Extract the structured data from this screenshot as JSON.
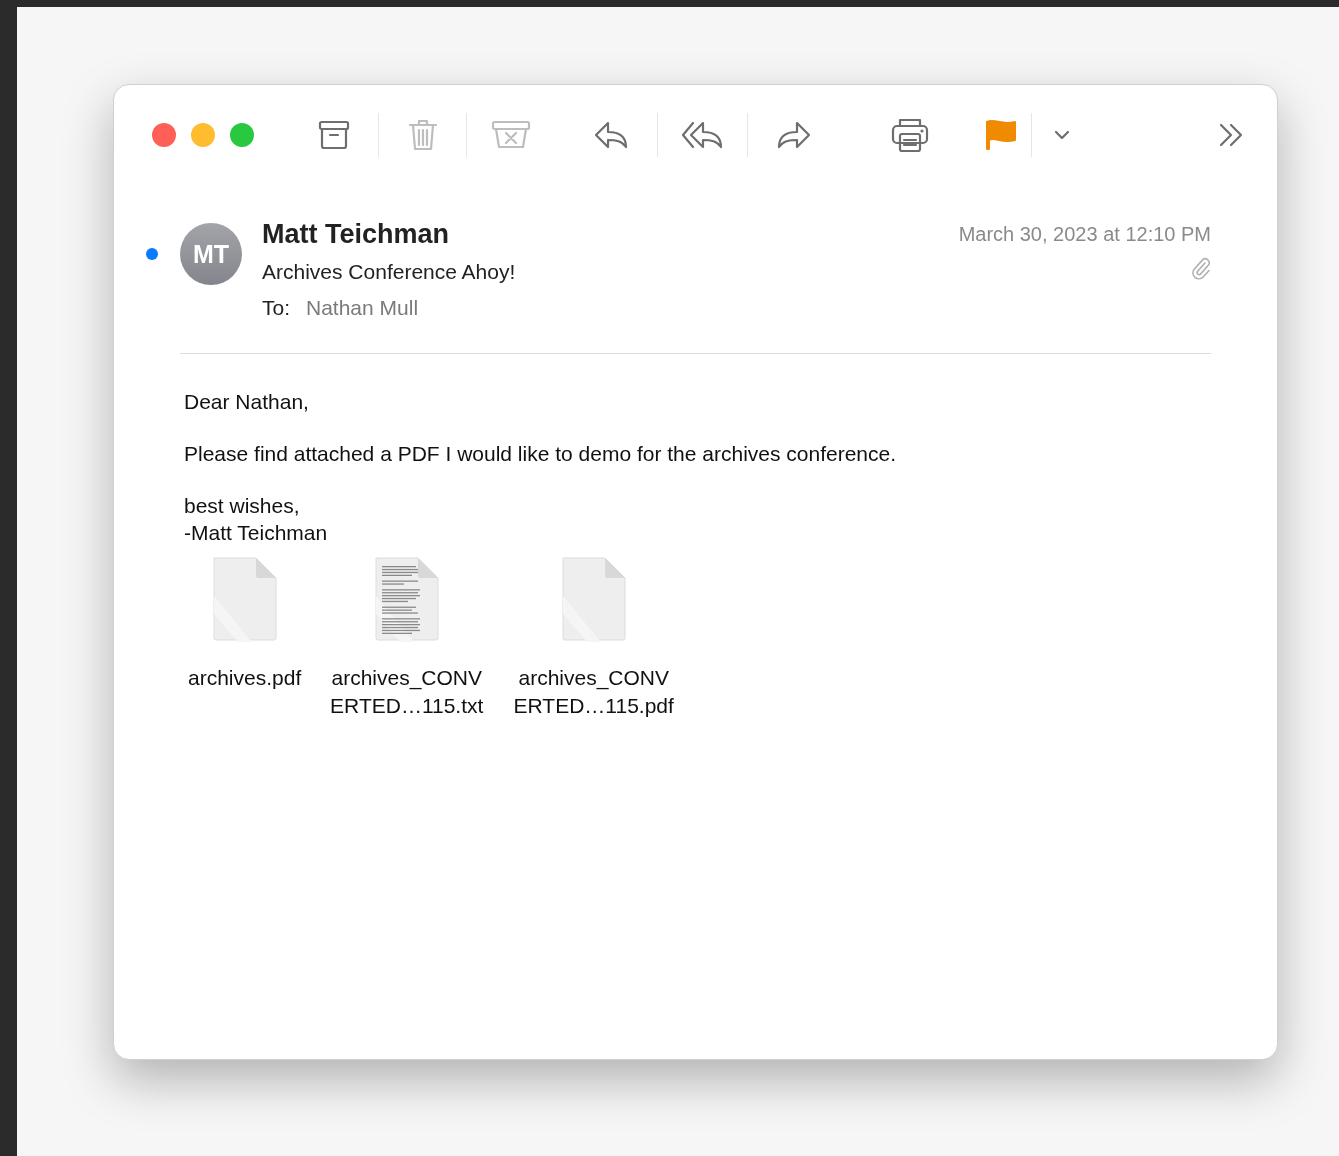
{
  "toolbar": {
    "groups": [
      [
        {
          "kind": "archive",
          "disabled": false
        },
        {
          "kind": "trash",
          "disabled": true
        },
        {
          "kind": "junk",
          "disabled": true
        }
      ],
      [
        {
          "kind": "reply",
          "disabled": false
        },
        {
          "kind": "reply-all",
          "disabled": false
        },
        {
          "kind": "forward",
          "disabled": false
        }
      ],
      [
        {
          "kind": "print",
          "disabled": false
        }
      ],
      [
        {
          "kind": "flag",
          "disabled": false,
          "color": "#f08a00"
        },
        {
          "kind": "chevron",
          "disabled": false
        }
      ]
    ],
    "more": {
      "kind": "more"
    }
  },
  "message": {
    "unread": true,
    "avatar_initials": "MT",
    "sender": "Matt Teichman",
    "subject": "Archives Conference Ahoy!",
    "date": "March 30, 2023 at 12:10 PM",
    "to_label": "To:",
    "to": "Nathan Mull"
  },
  "body": [
    "Dear Nathan,",
    "Please find attached a PDF I would like to demo for the archives conference.",
    "best wishes,\n-Matt Teichman"
  ],
  "attachments": [
    {
      "name": "archives.pdf",
      "kind": "blank"
    },
    {
      "name": "archives_CONVERTED…115.txt",
      "kind": "text"
    },
    {
      "name": "archives_CONVERTED…115.pdf",
      "kind": "blank"
    }
  ]
}
